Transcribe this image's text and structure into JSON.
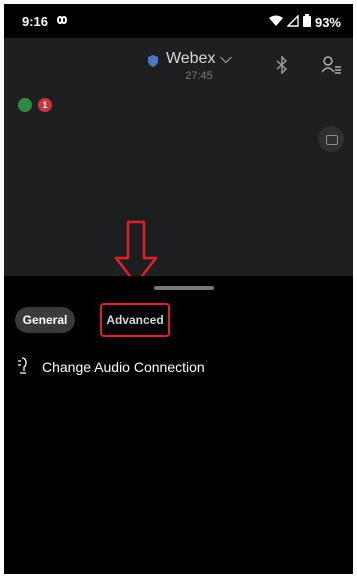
{
  "status_bar": {
    "time": "9:16",
    "battery": "93%"
  },
  "meeting": {
    "title": "Webex",
    "title_chevron": "⌵",
    "timer": "27:45",
    "alert_count": "1"
  },
  "icons": {
    "app_notification": "infinity-icon",
    "wifi": "wifi-icon",
    "cellular": "cellular-icon",
    "battery": "battery-icon",
    "shield": "shield-icon",
    "bluetooth": "bluetooth-icon",
    "participants": "participants-icon",
    "audio_connection": "audio-connection-icon"
  },
  "colors": {
    "accent_red": "#e21f26",
    "signal_green": "#2f8a3f",
    "alert_red": "#c9343e"
  },
  "tabs": [
    {
      "label": "General",
      "selected": true
    },
    {
      "label": "Advanced",
      "selected": false
    }
  ],
  "menu": {
    "items": [
      {
        "label": "Change Audio Connection"
      }
    ]
  }
}
